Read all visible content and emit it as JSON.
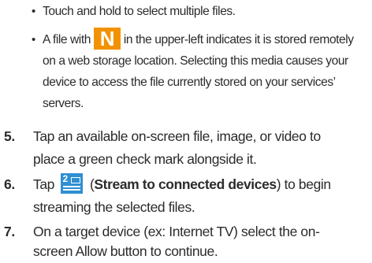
{
  "bullets": [
    {
      "text": "Touch and hold to select multiple files."
    },
    {
      "line1_before": "A file with",
      "icon": "n-icon",
      "line1_after": "in the upper-left indicates it is stored remotely",
      "line2": "on a web storage location. Selecting this media causes your",
      "line3": "device to access the file currently stored on your services’",
      "line4": "servers."
    }
  ],
  "bullet_symbol": "•",
  "steps": [
    {
      "number": "5.",
      "line1": "Tap an available on-screen file, image, or video to",
      "line2": "place a green check mark alongside it."
    },
    {
      "number": "6.",
      "tap": "Tap",
      "icon": "stream-icon",
      "icon_number": "2",
      "paren_open": "(",
      "bold_label": "Stream to connected devices",
      "paren_close": ")",
      "line1_after": "to begin",
      "line2": "streaming the selected files."
    },
    {
      "number": "7.",
      "line1": "On a target device (ex: Internet TV) select the on-",
      "line2": "screen Allow button to continue."
    }
  ],
  "colors": {
    "n_icon": "#f39200",
    "stream_icon": "#2f8fd1",
    "text": "#2b2b2b"
  }
}
